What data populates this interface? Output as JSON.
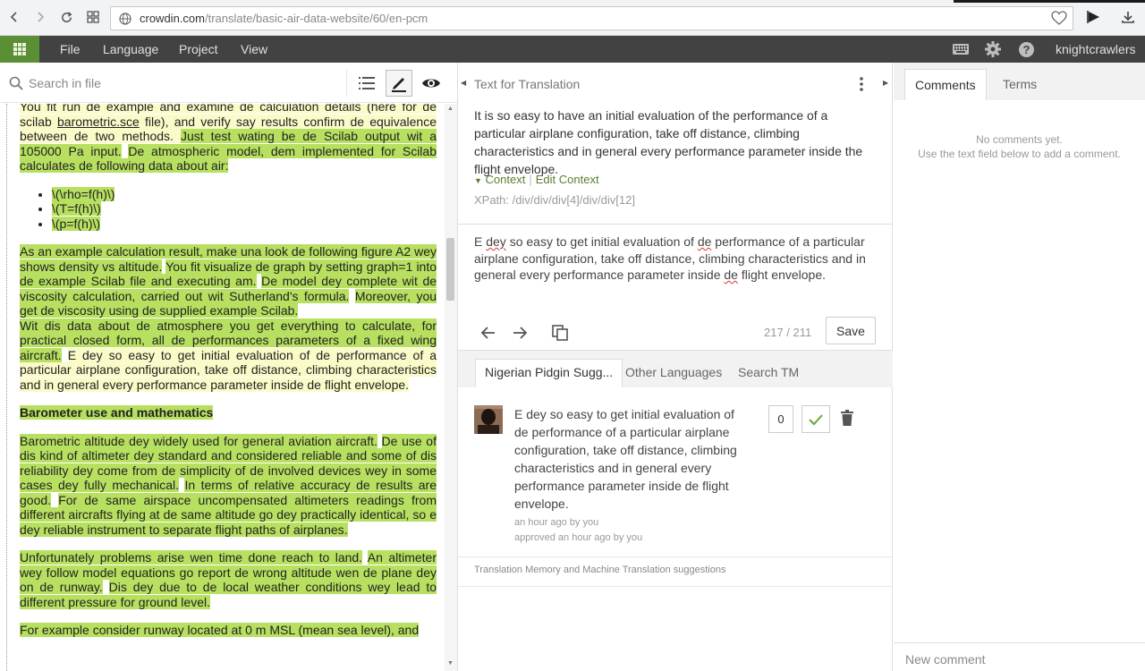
{
  "browser": {
    "url_domain": "crowdin.com",
    "url_path": "/translate/basic-air-data-website/60/en-pcm"
  },
  "header": {
    "menu": [
      "File",
      "Language",
      "Project",
      "View"
    ],
    "username": "knightcrawlers",
    "icons": [
      "apps-grid-icon",
      "keyboard-icon",
      "gear-icon",
      "help-icon"
    ]
  },
  "left": {
    "search_placeholder": "Search in file",
    "content": {
      "p1_a": "You fit run de example and examine de calculation details (here for de scilab ",
      "p1_link": "barometric.sce",
      "p1_b": " file), and verify say results confirm de equivalence between de two methods. ",
      "p1_c": "Just test wating be de Scilab output wit a 105000 Pa input.",
      "p1_d": " ",
      "p1_e": "De atmospheric model, dem implemented for Scilab calculates de following data about air:",
      "list": [
        "\\(\\rho=f(h)\\)",
        "\\(T=f(h)\\)",
        "\\(p=f(h)\\)"
      ],
      "p2_a": "As an example calculation result, make una look de following figure A2 wey shows density vs altitude.",
      "p2_b": "You fit visualize de graph by setting graph=1 into de example Scilab file and executing am.",
      "p2_c": "De model dey complete wit de viscosity calculation, carried out wit Sutherland's formula.",
      "p2_d": "Moreover, you get de viscosity using de supplied example Scilab.",
      "p2_e": "Wit dis data about de atmosphere you get everything to calculate, for practical closed form, all de performances parameters of a fixed wing aircraft.",
      "p2_f": "E dey so easy to get initial evaluation of de performance of a particular airplane configuration, take off distance, climbing characteristics and in general every performance parameter inside de flight envelope.",
      "heading": "Barometer use and mathematics",
      "p3_a": "Barometric altitude dey widely used for general aviation aircraft.",
      "p3_b": "De use of dis kind of altimeter dey standard and considered reliable and some of dis reliability dey come from de simplicity of de involved devices wey in some cases dey fully mechanical.",
      "p3_c": "In terms of relative accuracy de results are good.",
      "p3_d": "For de same airspace uncompensated altimeters readings from different aircrafts flying at de same altitude go dey practically identical, so e dey reliable instrument to separate flight paths of airplanes.",
      "p4_a": "Unfortunately problems arise wen time done reach to land.",
      "p4_b": "An altimeter wey follow model equations go report de wrong altitude wen de plane dey on de runway.",
      "p4_c": "Dis dey due to de local weather conditions wey lead to different pressure for ground level.",
      "p5_a": "For example consider runway located at 0 m MSL (mean sea level), and"
    }
  },
  "middle": {
    "title": "Text for Translation",
    "source": "It is so easy to have an initial evaluation of the performance of a particular airplane configuration, take off distance, climbing characteristics and in general every performance parameter inside the flight envelope.",
    "context_label": "Context",
    "edit_context_label": "Edit Context",
    "xpath": "XPath: /div/div/div[4]/div/div[12]",
    "translation": {
      "w1": "E ",
      "w2": "dey",
      "w3": " so easy to get initial evaluation of ",
      "w4": "de",
      "w5": " performance of a particular airplane configuration, take off distance, climbing characteristics and in general every performance parameter inside ",
      "w6": "de",
      "w7": " flight envelope."
    },
    "counter": "217 / 211",
    "save_label": "Save",
    "tabs": [
      "Nigerian Pidgin Sugg...",
      "Other Languages",
      "Search TM"
    ],
    "suggestion": {
      "text": "E dey so easy to get initial evaluation of de performance of a particular airplane configuration, take off distance, climbing characteristics and in general every performance parameter inside de flight envelope.",
      "meta1": "an hour ago by you",
      "meta2": "approved an hour ago by you",
      "votes": "0"
    },
    "tm_note": "Translation Memory and Machine Translation suggestions"
  },
  "right": {
    "tabs": [
      "Comments",
      "Terms"
    ],
    "empty_line1": "No comments yet.",
    "empty_line2": "Use the text field below to add a comment.",
    "new_comment_placeholder": "New comment"
  },
  "colors": {
    "brand_green": "#5a8f35",
    "segment_translated": "#b7e060",
    "segment_current": "#fafbc8",
    "header_bg": "#424242"
  }
}
